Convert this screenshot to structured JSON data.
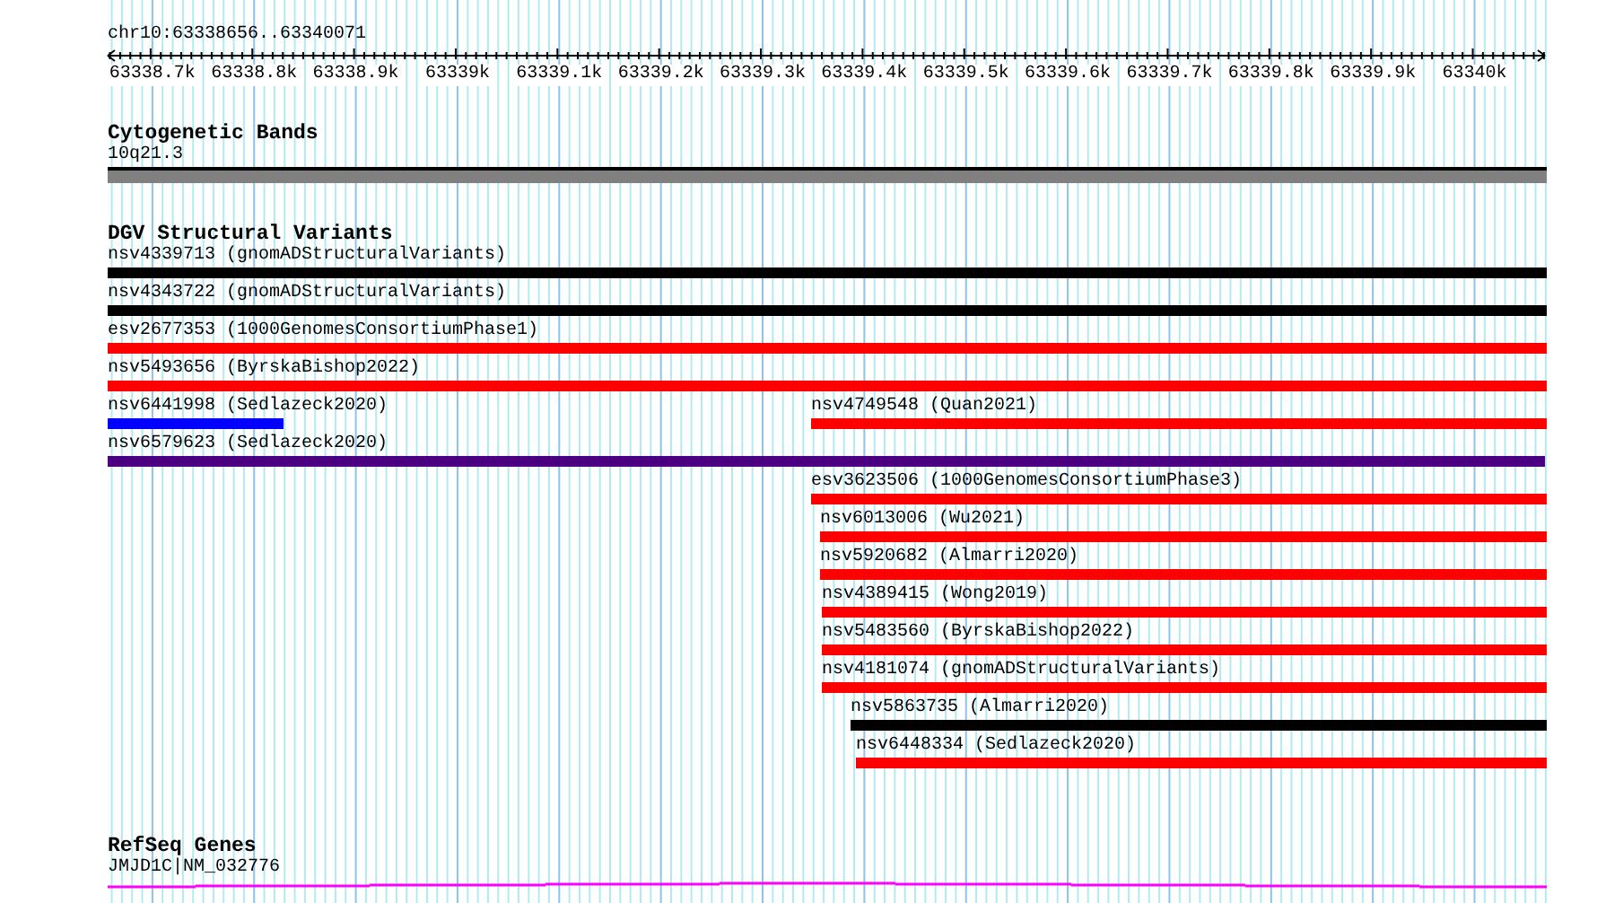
{
  "location": "chr10:63338656..63340071",
  "ruler": {
    "ticks": [
      "63338.7k",
      "63338.8k",
      "63338.9k",
      "63339k",
      "63339.1k",
      "63339.2k",
      "63339.3k",
      "63339.4k",
      "63339.5k",
      "63339.6k",
      "63339.7k",
      "63339.8k",
      "63339.9k",
      "63340k"
    ]
  },
  "tracks": [
    {
      "kind": "cytoband",
      "title": "Cytogenetic Bands",
      "label": "10q21.3"
    },
    {
      "kind": "variants",
      "title": "DGV Structural Variants",
      "rows": [
        {
          "features": [
            {
              "name": "nsv4339713 (gnomADStructuralVariants)",
              "color": "#000000"
            }
          ]
        },
        {
          "features": [
            {
              "name": "nsv4343722 (gnomADStructuralVariants)",
              "color": "#000000"
            }
          ]
        },
        {
          "features": [
            {
              "name": "esv2677353 (1000GenomesConsortiumPhase1)",
              "color": "#ff0000"
            }
          ]
        },
        {
          "features": [
            {
              "name": "nsv5493656 (ByrskaBishop2022)",
              "color": "#ff0000"
            }
          ]
        },
        {
          "features": [
            {
              "name": "nsv6441998 (Sedlazeck2020)",
              "color": "#0000ff"
            },
            {
              "name": "nsv4749548 (Quan2021)",
              "color": "#ff0000"
            }
          ]
        },
        {
          "features": [
            {
              "name": "nsv6579623 (Sedlazeck2020)",
              "color": "#4b0082"
            }
          ]
        },
        {
          "features": [
            {
              "name": "esv3623506 (1000GenomesConsortiumPhase3)",
              "color": "#ff0000"
            }
          ]
        },
        {
          "features": [
            {
              "name": "nsv6013006 (Wu2021)",
              "color": "#ff0000"
            }
          ]
        },
        {
          "features": [
            {
              "name": "nsv5920682 (Almarri2020)",
              "color": "#ff0000"
            }
          ]
        },
        {
          "features": [
            {
              "name": "nsv4389415 (Wong2019)",
              "color": "#ff0000"
            }
          ]
        },
        {
          "features": [
            {
              "name": "nsv5483560 (ByrskaBishop2022)",
              "color": "#ff0000"
            }
          ]
        },
        {
          "features": [
            {
              "name": "nsv4181074 (gnomADStructuralVariants)",
              "color": "#ff0000"
            }
          ]
        },
        {
          "features": [
            {
              "name": "nsv5863735 (Almarri2020)",
              "color": "#000000"
            }
          ]
        },
        {
          "features": [
            {
              "name": "nsv6448334 (Sedlazeck2020)",
              "color": "#ff0000"
            }
          ]
        }
      ]
    },
    {
      "kind": "genes",
      "title": "RefSeq Genes",
      "label": "JMJD1C|NM_032776"
    }
  ]
}
